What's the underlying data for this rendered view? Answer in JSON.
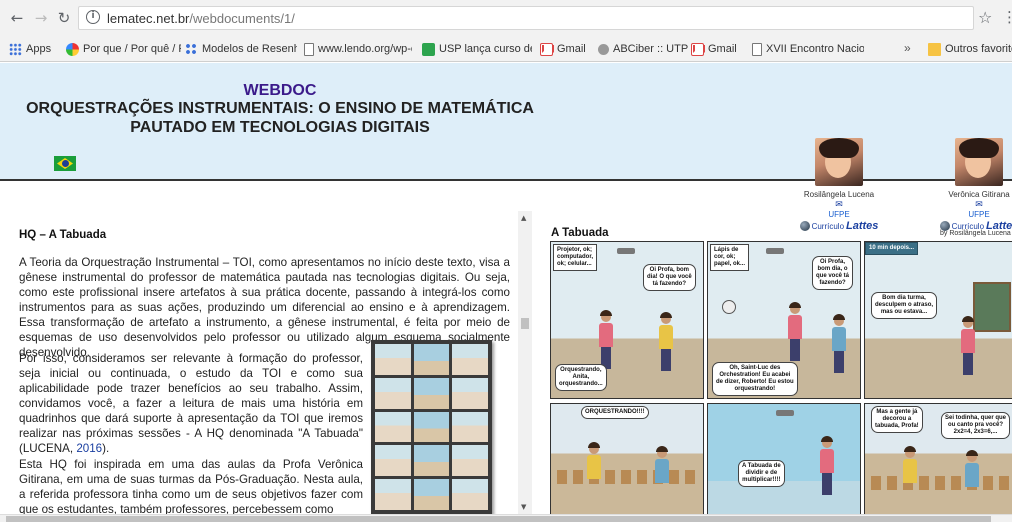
{
  "browser": {
    "url_host": "lematec.net.br",
    "url_path": "/webdocuments/1/",
    "back_icon": "arrow-left-icon",
    "forward_icon": "arrow-right-icon",
    "reload_icon": "reload-icon",
    "bookmarks": [
      {
        "label": "Apps",
        "icon": "apps-icon"
      },
      {
        "label": "Por que / Por quê / P",
        "icon": "site-icon"
      },
      {
        "label": "Modelos de Resenha",
        "icon": "site-icon"
      },
      {
        "label": "www.lendo.org/wp-c",
        "icon": "page-icon"
      },
      {
        "label": "USP lança curso de e",
        "icon": "site-icon"
      },
      {
        "label": "Gmail",
        "icon": "gmail-icon"
      },
      {
        "label": "ABCiber :: UTP",
        "icon": "site-icon"
      },
      {
        "label": "Gmail",
        "icon": "gmail-icon"
      },
      {
        "label": "XVII Encontro Nacion",
        "icon": "page-icon"
      }
    ],
    "bookmarks_more": "»",
    "other_bookmarks": "Outros favoritos"
  },
  "header": {
    "webdoc": "WEBDOC",
    "title_line1": "ORQUESTRAÇÕES INSTRUMENTAIS: O ENSINO DE MATEMÁTICA",
    "title_line2": "PAUTADO EM TECNOLOGIAS DIGITAIS",
    "authors": [
      {
        "name": "Rosilângela Lucena",
        "institution": "UFPE",
        "curriculum": "Currículo",
        "lattes": "Lattes"
      },
      {
        "name": "Verônica Gitirana",
        "institution": "UFPE",
        "curriculum": "Currículo",
        "lattes": "Lattes"
      }
    ]
  },
  "article": {
    "title": "HQ – A Tabuada",
    "p1": "A Teoria da Orquestração Instrumental – TOI, como apresentamos no início deste texto, visa a gênese instrumental do professor de matemática pautada nas tecnologias digitais. Ou seja, como este profissional insere artefatos à sua prática docente, passando à integrá-los como instrumentos para as suas ações, produzindo um diferencial ao ensino e à aprendizagem. Essa transformação de artefato a instrumento, a gênese instrumental, é feita por meio de esquemas de uso desenvolvidos pelo professor ou utilizado algum esquema socialmente desenvolvido.",
    "p2_before": "Por isso, consideramos ser relevante à formação do professor, seja inicial ou continuada, o estudo da TOI e como sua aplicabilidade pode trazer benefícios ao seu trabalho. Assim, convidamos você, a fazer a leitura de mais uma história em quadrinhos que dará suporte à apresentação da TOI que iremos realizar nas próximas sessões - A HQ denominada \"A Tabuada\" (LUCENA, ",
    "p2_year": "2016",
    "p2_after": ").",
    "p3": "Esta HQ foi inspirada em uma das aulas da Profa Verônica Gitirana, em uma de suas turmas da Pós-Graduação. Nesta aula, a referida professora tinha como um de seus objetivos fazer com que os estudantes, também professores, percebessem como"
  },
  "comic": {
    "title": "A Tabuada",
    "byline": "by Rosilângela Lucena",
    "p1_caption": "Projetor, ok;\ncomputador,\nok; celular...",
    "p1_bubble1": "Oi Profa, bom\ndia! O que você\ntá fazendo?",
    "p1_bubble2": "Orquestrando,\nAnita,\norquestrando...",
    "p2_caption": "Lápis de\ncor, ok;\npapel, ok...",
    "p2_bubble1": "Oi Profa,\nbom dia, o\nque você tá\nfazendo?",
    "p2_bubble2": "Oh, Saint-Luc des\nOrchestration! Eu acabei\nde dizer, Roberto! Eu estou\norquestrando!",
    "p3_caption": "10 min depois...",
    "p3_bubble1": "Bom dia turma,\ndesculpem o atraso,\nmas ou estava...",
    "p4_bubble1": "ORQUESTRANDO!!!!",
    "p5_bubble1": "A Tabuada de\ndividir e de\nmultiplicar!!!!",
    "p6_bubble1": "Mas a gente já\ndecorou a\ntabuada, Profa!",
    "p6_bubble2": "Sei todinha, quer que\nou canto pra você?\n2x2=4, 2x3=6,..."
  }
}
